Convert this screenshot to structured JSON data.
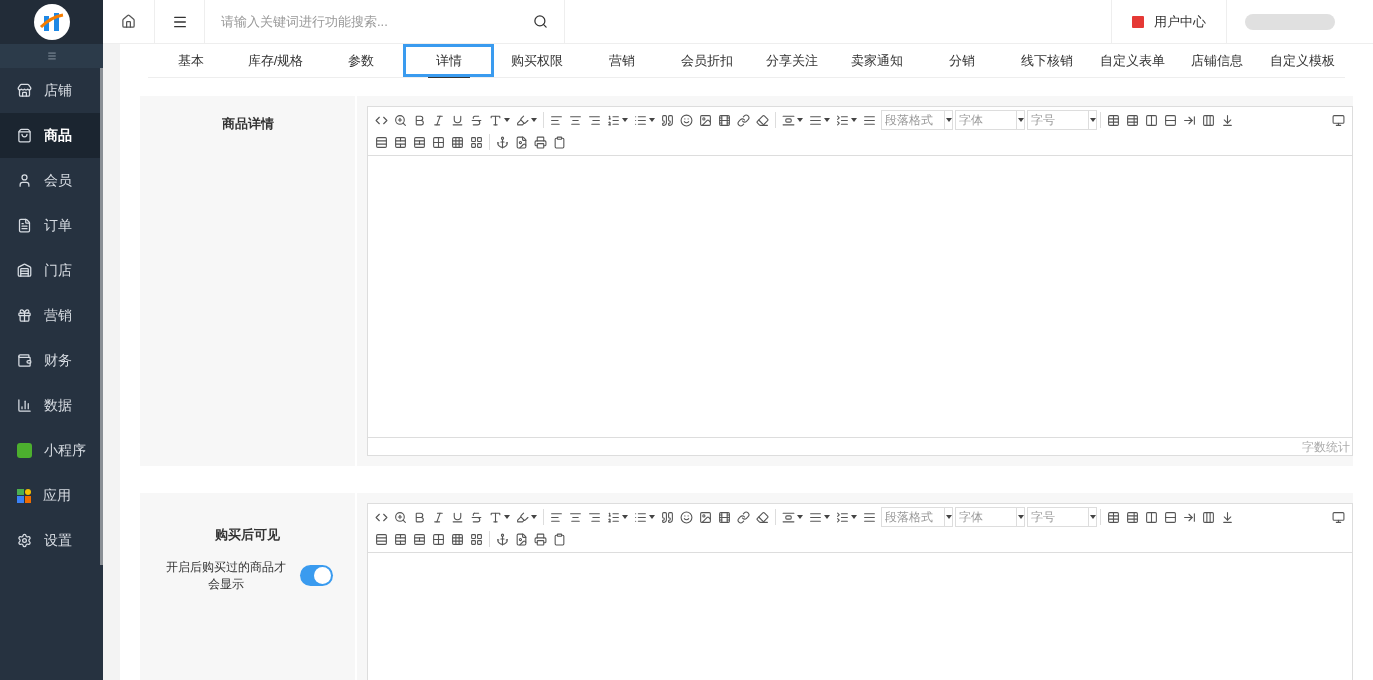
{
  "sidebar": {
    "items": [
      {
        "label": "店铺",
        "selected": false
      },
      {
        "label": "商品",
        "selected": true
      },
      {
        "label": "会员",
        "selected": false
      },
      {
        "label": "订单",
        "selected": false
      },
      {
        "label": "门店",
        "selected": false
      },
      {
        "label": "营销",
        "selected": false
      },
      {
        "label": "财务",
        "selected": false
      },
      {
        "label": "数据",
        "selected": false
      },
      {
        "label": "小程序",
        "selected": false
      },
      {
        "label": "应用",
        "selected": false
      },
      {
        "label": "设置",
        "selected": false
      }
    ]
  },
  "topbar": {
    "search": {
      "placeholder": "请输入关键词进行功能搜索..."
    },
    "user_center": "用户中心"
  },
  "tabs": [
    {
      "label": "基本",
      "selected": false
    },
    {
      "label": "库存/规格",
      "selected": false
    },
    {
      "label": "参数",
      "selected": false
    },
    {
      "label": "详情",
      "selected": true
    },
    {
      "label": "购买权限",
      "selected": false
    },
    {
      "label": "营销",
      "selected": false
    },
    {
      "label": "会员折扣",
      "selected": false
    },
    {
      "label": "分享关注",
      "selected": false
    },
    {
      "label": "卖家通知",
      "selected": false
    },
    {
      "label": "分销",
      "selected": false
    },
    {
      "label": "线下核销",
      "selected": false
    },
    {
      "label": "自定义表单",
      "selected": false
    },
    {
      "label": "店铺信息",
      "selected": false
    },
    {
      "label": "自定义模板",
      "selected": false
    }
  ],
  "sections": [
    {
      "label": "商品详情",
      "selects": [
        "段落格式",
        "字体",
        "字号"
      ],
      "word_count": "字数统计"
    },
    {
      "label": "购买后可见",
      "note": "开启后购买过的商品才会显示",
      "toggle_on": true,
      "selects": [
        "段落格式",
        "字体",
        "字号"
      ]
    }
  ]
}
